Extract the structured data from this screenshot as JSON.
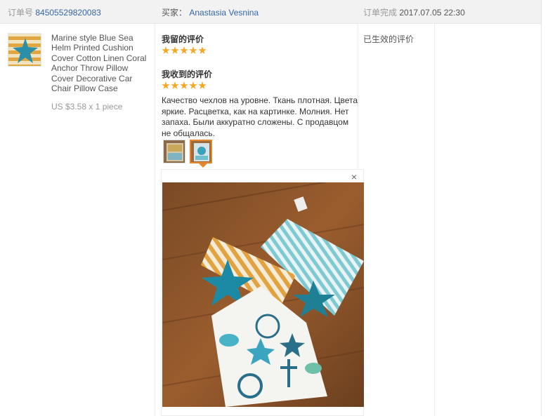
{
  "order": {
    "number_label": "订单号",
    "number": "84505529820083",
    "buyer_label": "买家：",
    "buyer_name": "Anastasia Vesnina",
    "completed_label": "订单完成",
    "completed_date": "2017.07.05 22:30"
  },
  "product": {
    "title": "Marine style Blue Sea Helm Printed Cushion Cover Cotton Linen Coral Anchor Throw Pillow Cover Decorative Car Chair Pillow Case",
    "price": "US $3.58 x 1 piece"
  },
  "review": {
    "my_rating_title": "我留的评价",
    "my_rating_stars": 5,
    "received_rating_title": "我收到的评价",
    "received_rating_stars": 5,
    "text": "Качество чехлов на уровне. Ткань плотная. Цвета яркие. Расцветка, как на картинке. Молния. Нет запаха. Были аккуратно сложены. С продавцом не общалась.",
    "effective_text": "已生效的评价",
    "close_symbol": "×",
    "selected_thumbnail": 2
  },
  "icons": {
    "close": "close-icon",
    "star": "star-icon"
  },
  "colors": {
    "link": "#3366aa",
    "star": "#f5a623",
    "selected_border": "#e5862a",
    "header_bg": "#f2f2f2"
  }
}
